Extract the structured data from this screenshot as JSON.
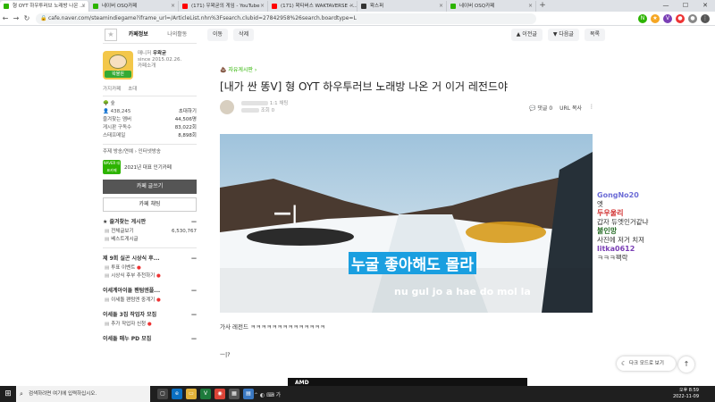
{
  "browser": {
    "tabs": [
      {
        "label": "형 OYT 하우투러브 노래방 나온 ...",
        "fav": "#2db400",
        "active": true
      },
      {
        "label": "네이버 OSQ카페",
        "fav": "#2db400",
        "active": false
      },
      {
        "label": "(171) 우왁굳의 게임 - YouTube",
        "fav": "#f00",
        "active": false
      },
      {
        "label": "(171) 왁타버스 WAKTAVERSE - ...",
        "fav": "#f00",
        "active": false
      },
      {
        "label": "왁스퍼",
        "fav": "#333",
        "active": false
      },
      {
        "label": "네이버 OSQ카페",
        "fav": "#2db400",
        "active": false
      }
    ],
    "new_tab": "+",
    "url": "cafe.naver.com/steamindiegame?iframe_url=/ArticleList.nhn%3Fsearch.clubid=27842958%26search.boardtype=L",
    "window_controls": [
      "—",
      "☐",
      "✕"
    ]
  },
  "sidebar": {
    "tab_info": "카페정보",
    "tab_activity": "나의활동",
    "cafe_img_label": "왁물원",
    "manager_label": "매니저",
    "manager_name": "우왁굳",
    "since": "since 2015.02.26.",
    "invite": "카페소개",
    "cafe_rank": "가지카페",
    "invite_link": "초대",
    "level": "숲",
    "members": "438,245",
    "invite_btn": "초대하기",
    "stats": [
      {
        "label": "즐겨찾는 멤버",
        "value": "44,506명"
      },
      {
        "label": "게시판 구독수",
        "value": "83,022회"
      },
      {
        "label": "스태프메일",
        "value": "8,898회"
      }
    ],
    "more_links": "주제 방송/연예 › 인터넷방송",
    "award_badge": "NAVER 대표카페",
    "award_text": "2021년 대표 인기카페",
    "write_btn": "카페 글쓰기",
    "chat_btn": "카페 채팅",
    "fav_board_head": "즐겨찾는 게시판",
    "fav_boards": [
      {
        "label": "전체글보기",
        "count": "6,530,767"
      },
      {
        "label": "베스트게시글",
        "count": ""
      }
    ],
    "section2_head": "제 9회 실곤 시상식 후...",
    "section2_items": [
      "투표 이벤트",
      "시상식 후부 추천하기"
    ],
    "section3_head": "이세계아이돌 팬텀엔플...",
    "section3_items": [
      "이세돌 팬텀엔 중계기"
    ],
    "section4_head": "이세돌 3집 작업자 모집",
    "section4_items": [
      "추가 작업자 신청"
    ],
    "section5_head": "이세돌 매누 PD 모집"
  },
  "toolbar": {
    "move": "이동",
    "delete": "삭제",
    "prev": "이전글",
    "next": "다음글",
    "list": "목록"
  },
  "post": {
    "board": "자유게시판",
    "title": "[내가 싼 똥ᐯ] 형 OYT 하우투러브 노래방 나온 거 이거 레전드야",
    "author_level": "1:1 채팅",
    "date_views": "조회 0",
    "comments": "댓글 0",
    "url_copy": "URL 복사",
    "more": "⋮",
    "video_caption_ko": "누굴 좋아해도 몰라",
    "video_caption_rom": "nu gul  jo a hae do  mol la",
    "video_dash": "—|",
    "lyric_line": "가사 레전드 ㅋㅋㅋㅋㅋㅋㅋㅋㅋㅋㅋㅋㅋㅋ",
    "question": "ㅡ|?",
    "embed_text": "AMD"
  },
  "chat": [
    {
      "user": "GongNo20",
      "ucolor": "#6b6bd6",
      "msg": "엣"
    },
    {
      "user": "두우울리",
      "ucolor": "#d12f2f",
      "msg": "갑자 듀엣인거같냐"
    },
    {
      "user": "불인망",
      "ucolor": "#2a6f2a",
      "msg": "사진에 저거 치져"
    },
    {
      "user": "litka0612",
      "ucolor": "#7a3fb5",
      "msg": "ㅋㅋㅋ팩락"
    }
  ],
  "darkmode_label": "다크 모드로 보기",
  "totop": "↑",
  "taskbar": {
    "search_placeholder": "검색하려면 여기에 입력하십시오.",
    "time": "오후 8:59",
    "date": "2022-11-09"
  }
}
